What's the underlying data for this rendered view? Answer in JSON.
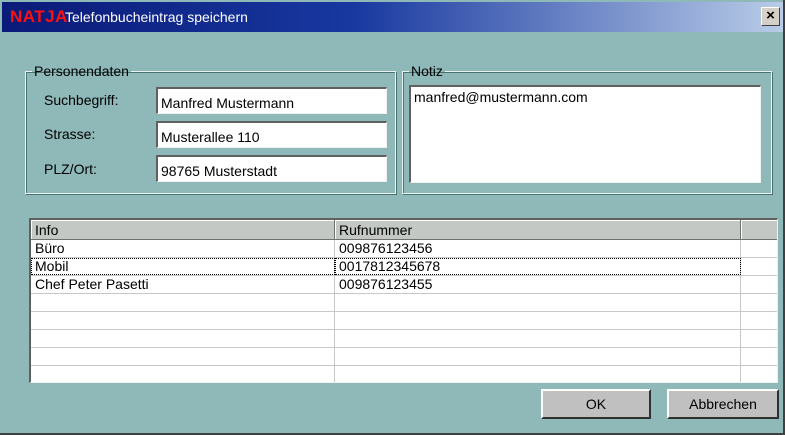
{
  "window": {
    "brand": "NATJA",
    "title": "Telefonbucheintrag speichern",
    "close_label": "×"
  },
  "personendaten": {
    "legend": "Personendaten",
    "fields": [
      {
        "label": "Suchbegriff:",
        "value": "Manfred Mustermann"
      },
      {
        "label": "Strasse:",
        "value": "Musterallee 110"
      },
      {
        "label": "PLZ/Ort:",
        "value": "98765 Musterstadt"
      }
    ]
  },
  "notiz": {
    "legend": "Notiz",
    "value": "manfred@mustermann.com"
  },
  "table": {
    "columns": [
      "Info",
      "Rufnummer"
    ],
    "rows": [
      {
        "info": "Büro",
        "nummer": "009876123456"
      },
      {
        "info": "Mobil",
        "nummer": "0017812345678"
      },
      {
        "info": "Chef Peter Pasetti",
        "nummer": "009876123455"
      }
    ]
  },
  "buttons": {
    "ok": "OK",
    "cancel": "Abbrechen"
  }
}
